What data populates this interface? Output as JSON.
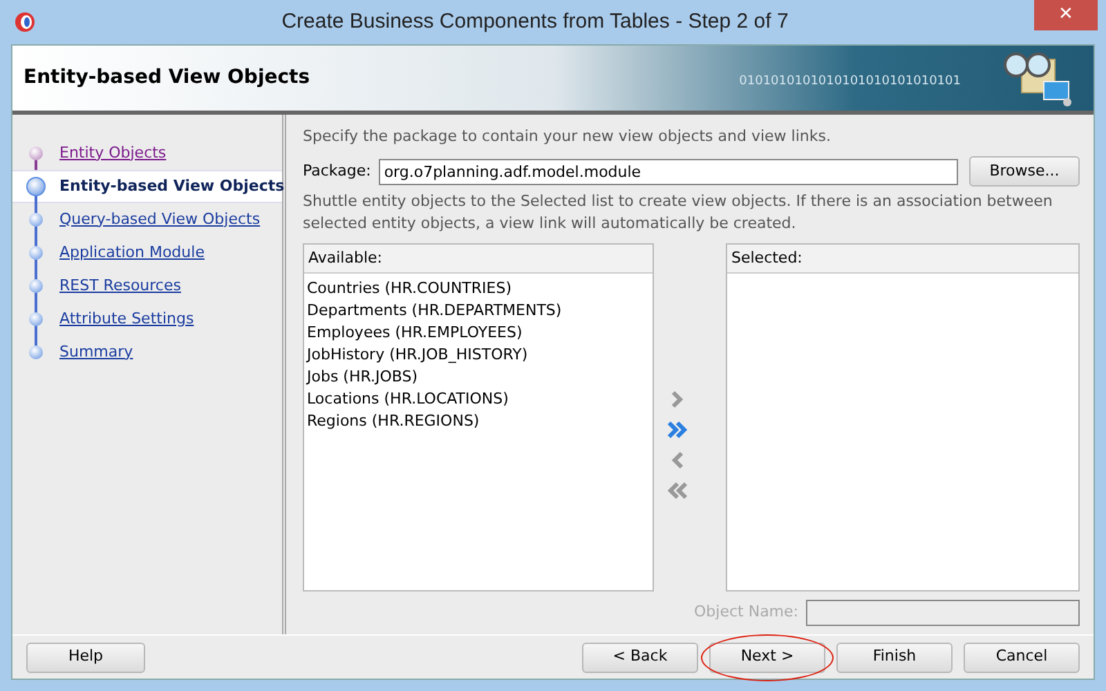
{
  "window": {
    "title": "Create Business Components from Tables - Step 2 of 7",
    "close": "✕"
  },
  "header": {
    "title": "Entity-based View Objects",
    "binary_text": "0101010101010101010101010101"
  },
  "steps": [
    {
      "label": "Entity Objects",
      "selected": false,
      "visited": true
    },
    {
      "label": "Entity-based View Objects",
      "selected": true,
      "visited": false
    },
    {
      "label": "Query-based View Objects",
      "selected": false,
      "visited": false
    },
    {
      "label": "Application Module",
      "selected": false,
      "visited": false
    },
    {
      "label": "REST Resources",
      "selected": false,
      "visited": false
    },
    {
      "label": "Attribute Settings",
      "selected": false,
      "visited": false
    },
    {
      "label": "Summary",
      "selected": false,
      "visited": false
    }
  ],
  "intro": "Specify the package to contain your new view objects and view links.",
  "package": {
    "label": "Package:",
    "value": "org.o7planning.adf.model.module",
    "browse": "Browse..."
  },
  "hint": "Shuttle entity objects to the Selected list to create view objects.  If there is an association between selected entity objects, a view link will automatically be created.",
  "available": {
    "heading": "Available:",
    "items": [
      "Countries (HR.COUNTRIES)",
      "Departments (HR.DEPARTMENTS)",
      "Employees (HR.EMPLOYEES)",
      "JobHistory (HR.JOB_HISTORY)",
      "Jobs (HR.JOBS)",
      "Locations (HR.LOCATIONS)",
      "Regions (HR.REGIONS)"
    ]
  },
  "shuttle": [
    {
      "kind": "add",
      "disabled": true
    },
    {
      "kind": "add_all",
      "disabled": false
    },
    {
      "kind": "remove",
      "disabled": true
    },
    {
      "kind": "remove_all",
      "disabled": true
    }
  ],
  "selected_list": {
    "heading": "Selected:"
  },
  "object_name": {
    "label": "Object Name:",
    "disabled": true
  },
  "buttons": [
    {
      "label": "Help",
      "highlighted": false
    },
    {
      "label": "< Back",
      "highlighted": false
    },
    {
      "label": "Next >",
      "highlighted": true
    },
    {
      "label": "Finish",
      "highlighted": false
    },
    {
      "label": "Cancel",
      "highlighted": false
    }
  ]
}
